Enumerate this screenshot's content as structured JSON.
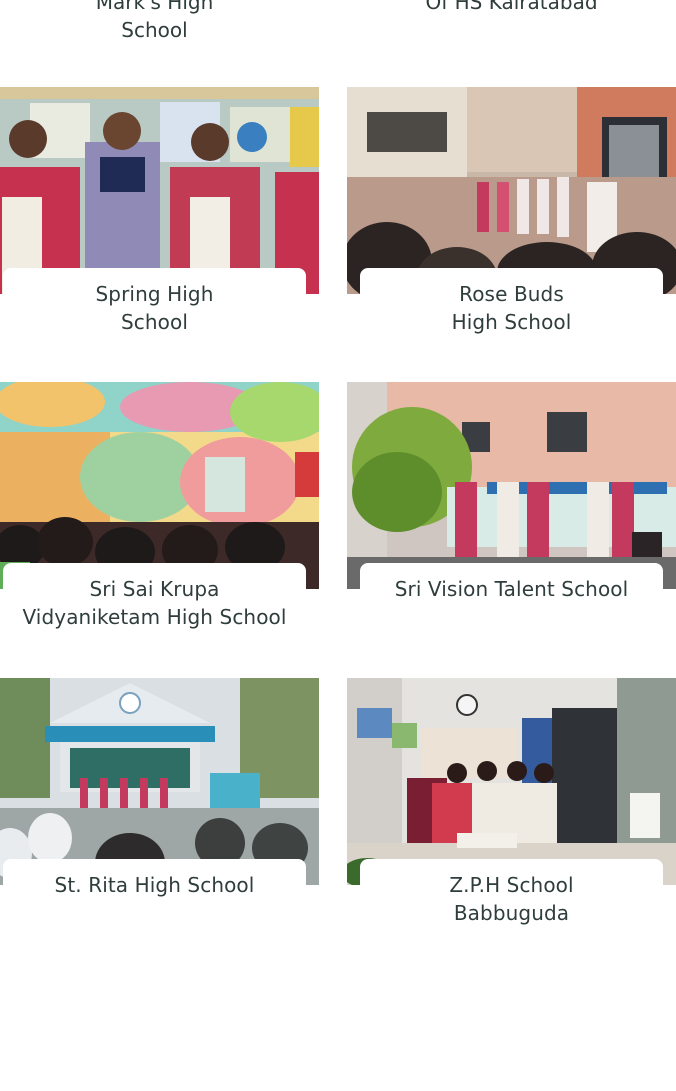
{
  "top_row": {
    "left_lines": [
      "Mark's High",
      "School"
    ],
    "right_lines": [
      "Of HS Kairatabad"
    ]
  },
  "schools": [
    {
      "name_lines": [
        "Spring High",
        "School"
      ],
      "photo": "students-presenting-classroom"
    },
    {
      "name_lines": [
        "Rose Buds",
        "High School"
      ],
      "photo": "staff-assembly-courtyard"
    },
    {
      "name_lines": [
        "Sri Sai Krupa",
        "Vidyaniketam High School"
      ],
      "photo": "painted-classroom-students"
    },
    {
      "name_lines": [
        "Sri Vision Talent School"
      ],
      "photo": "teachers-outdoor-banner"
    },
    {
      "name_lines": [
        "St. Rita High School"
      ],
      "photo": "school-building-assembly"
    },
    {
      "name_lines": [
        "Z.P.H School",
        "Babbuguda"
      ],
      "photo": "teachers-office-room"
    }
  ],
  "colors": {
    "text": "#2f3d3c",
    "card_bg": "#ffffff",
    "saree_pink": "#c8375a"
  }
}
